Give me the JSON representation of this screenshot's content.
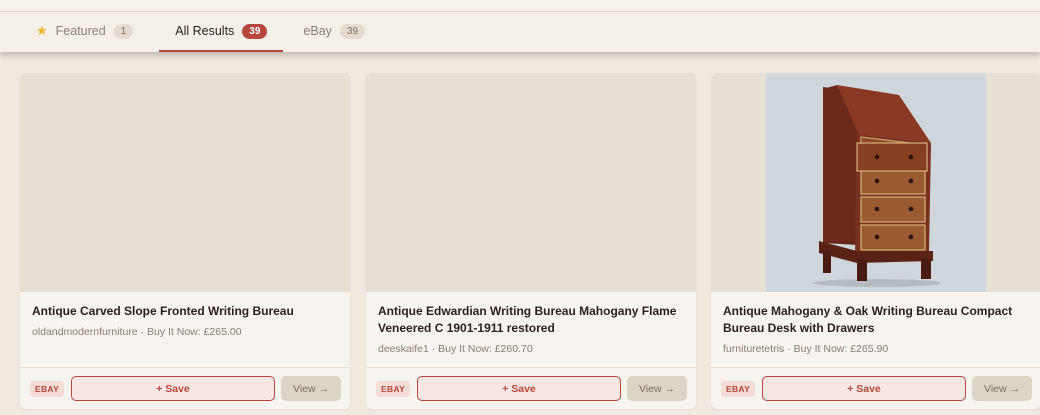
{
  "tabs": [
    {
      "label": "Featured",
      "count": "1",
      "icon": "star-icon"
    },
    {
      "label": "All Results",
      "count": "39"
    },
    {
      "label": "eBay",
      "count": "39"
    }
  ],
  "cards": [
    {
      "title": "Antique Carved Slope Fronted Writing Bureau",
      "meta": "oldandmodernfurniture · Buy It Now: £265.00",
      "badge": "EBAY",
      "save_label": "+ Save",
      "view_label": "View →"
    },
    {
      "title": "Antique Edwardian Writing Bureau Mahogany Flame Veneered C 1901-1911 restored",
      "meta": "deeskaife1 · Buy It Now: £260.70",
      "badge": "EBAY",
      "save_label": "+ Save",
      "view_label": "View →"
    },
    {
      "title": "Antique Mahogany & Oak Writing Bureau Compact Bureau Desk with Drawers",
      "meta": "furnituretetris · Buy It Now: £265.90",
      "badge": "EBAY",
      "save_label": "+ Save",
      "view_label": "View →"
    }
  ],
  "colors": {
    "accent": "#b5473c",
    "background": "#efe9e0",
    "card": "#f7f3ee"
  }
}
